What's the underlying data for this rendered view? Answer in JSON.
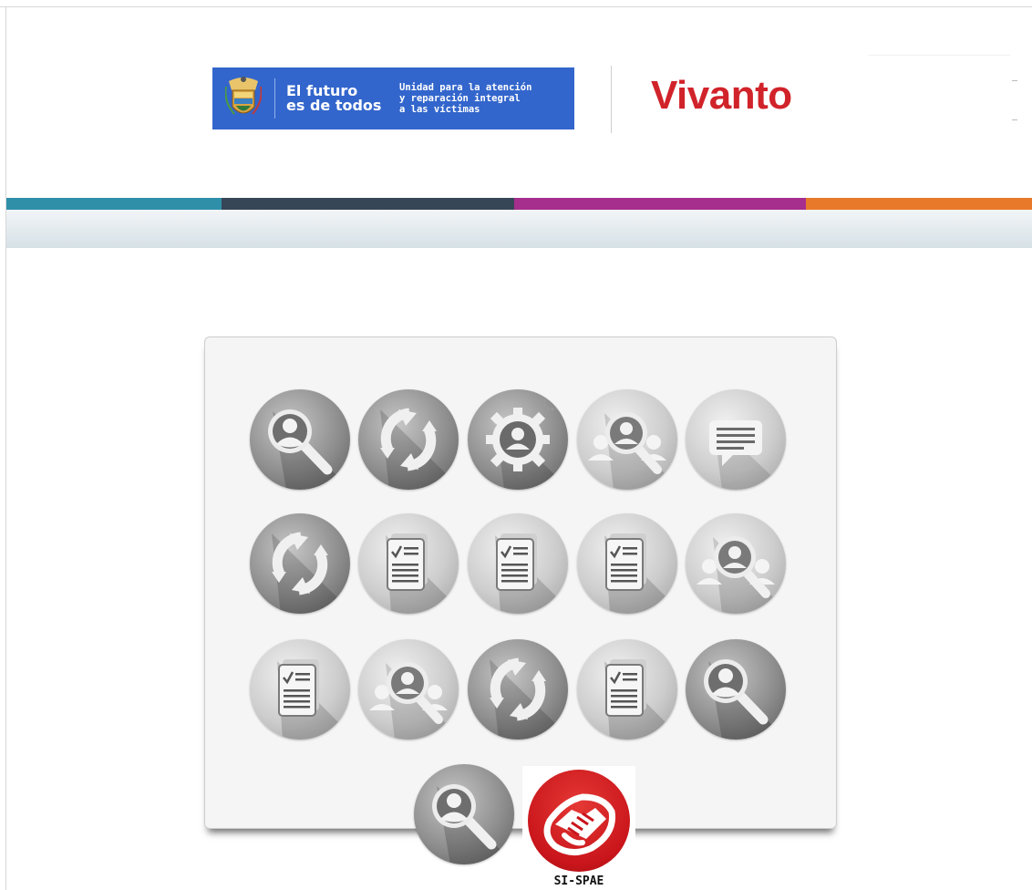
{
  "header": {
    "slogan_line1": "El futuro",
    "slogan_line2": "es de todos",
    "entity_line1": "Unidad para la atención",
    "entity_line2": "y reparación integral",
    "entity_line3": "a las víctimas",
    "brand": "Vivanto",
    "crest_icon": "colombia-coat-of-arms-icon"
  },
  "colors": {
    "gov_blue": "#3366cc",
    "brand_red": "#d1232a",
    "stripe": [
      "#2f8fa9",
      "#374657",
      "#a62e8d",
      "#e8782a"
    ]
  },
  "apps": {
    "row1": [
      "user-search-icon",
      "refresh-icon",
      "user-settings-icon",
      "group-search-icon",
      "message-icon"
    ],
    "row2": [
      "refresh-icon",
      "checklist-document-icon",
      "checklist-document-icon",
      "checklist-document-icon",
      "group-search-icon"
    ],
    "row3": [
      "checklist-document-icon",
      "group-search-icon",
      "refresh-icon",
      "checklist-document-icon",
      "user-search-icon"
    ],
    "row4": [
      "user-search-icon",
      "handshake-icon"
    ]
  },
  "sispae": {
    "label": "SI-SPAE"
  }
}
